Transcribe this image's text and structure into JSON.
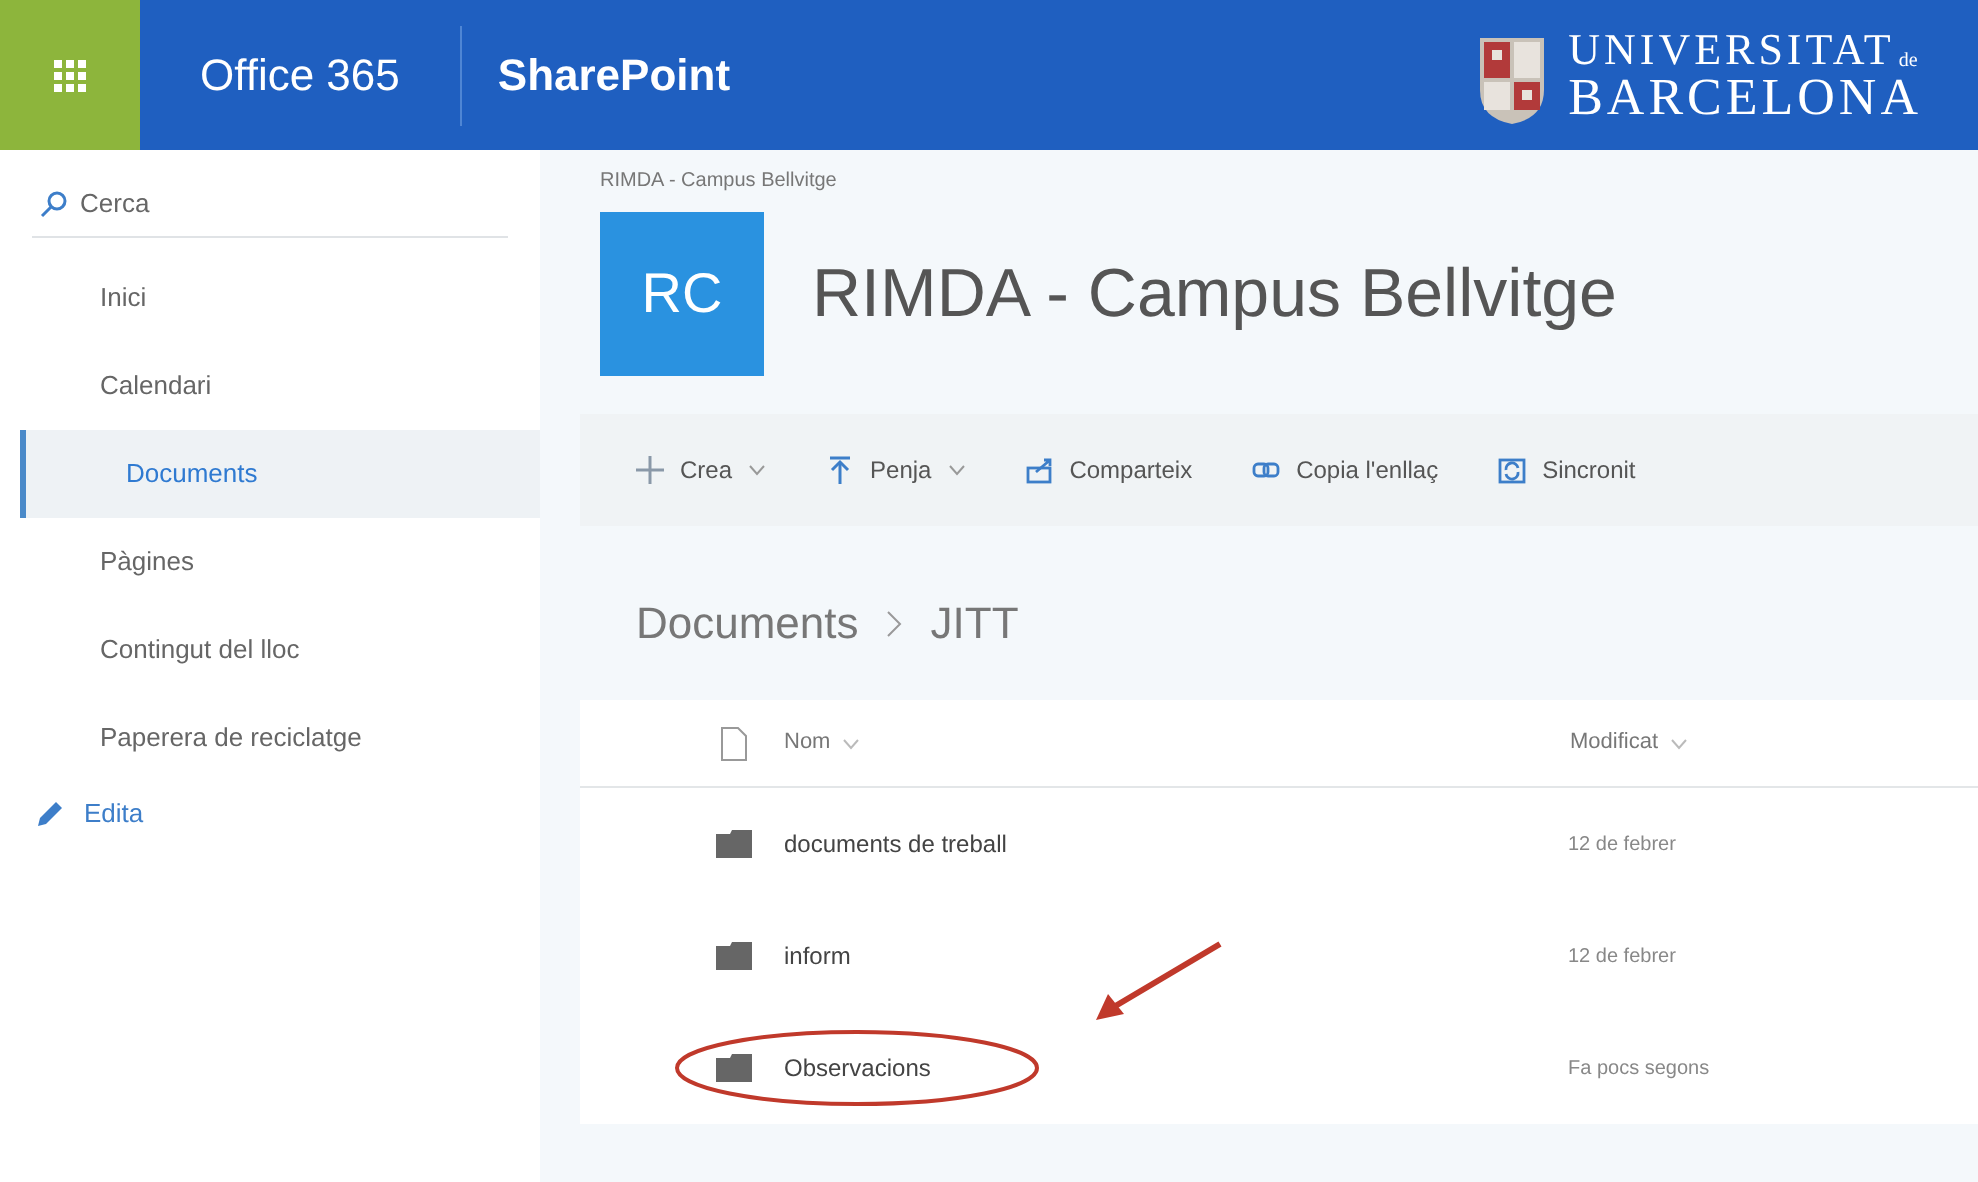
{
  "suite_bar": {
    "office": "Office 365",
    "app": "SharePoint",
    "logo_line1": "UNIVERSITAT",
    "logo_small": "de",
    "logo_line2": "BARCELONA"
  },
  "search": {
    "placeholder": "Cerca"
  },
  "nav": [
    {
      "label": "Inici",
      "selected": false
    },
    {
      "label": "Calendari",
      "selected": false
    },
    {
      "label": "Documents",
      "selected": true
    },
    {
      "label": "Pàgines",
      "selected": false
    },
    {
      "label": "Contingut del lloc",
      "selected": false
    },
    {
      "label": "Paperera de reciclatge",
      "selected": false
    }
  ],
  "edit_link": "Edita",
  "site": {
    "breadcrumb": "RIMDA - Campus Bellvitge",
    "initials": "RC",
    "title": "RIMDA - Campus Bellvitge"
  },
  "commands": [
    {
      "kind": "plus",
      "label": "Crea",
      "dropdown": true
    },
    {
      "kind": "upload",
      "label": "Penja",
      "dropdown": true
    },
    {
      "kind": "share",
      "label": "Comparteix",
      "dropdown": false
    },
    {
      "kind": "link",
      "label": "Copia l'enllaç",
      "dropdown": false
    },
    {
      "kind": "sync",
      "label": "Sincronit",
      "dropdown": false
    }
  ],
  "path": [
    "Documents",
    "JITT"
  ],
  "table": {
    "columns": [
      "Nom",
      "Modificat"
    ],
    "rows": [
      {
        "name": "documents de treball",
        "modified": "12 de febrer",
        "highlighted": false
      },
      {
        "name": "inform",
        "modified": "12 de febrer",
        "highlighted": false
      },
      {
        "name": "Observacions",
        "modified": "Fa pocs segons",
        "highlighted": true
      }
    ]
  }
}
